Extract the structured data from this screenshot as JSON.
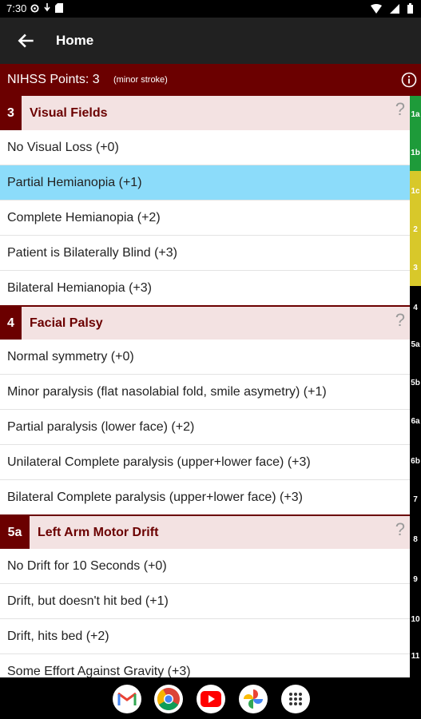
{
  "status_bar": {
    "time": "7:30"
  },
  "app_bar": {
    "title": "Home"
  },
  "score": {
    "label": "NIHSS Points: 3",
    "severity": "(minor stroke)"
  },
  "sections": [
    {
      "number": "3",
      "title": "Visual Fields",
      "help": "?",
      "options": [
        "No Visual Loss (+0)",
        "Partial Hemianopia (+1)",
        "Complete Hemianopia (+2)",
        "Patient is Bilaterally Blind (+3)",
        "Bilateral Hemianopia (+3)"
      ]
    },
    {
      "number": "4",
      "title": "Facial Palsy",
      "help": "?",
      "options": [
        "Normal symmetry (+0)",
        "Minor paralysis (flat nasolabial fold, smile asymetry) (+1)",
        "Partial paralysis (lower face) (+2)",
        "Unilateral Complete paralysis (upper+lower face) (+3)",
        "Bilateral Complete paralysis (upper+lower face) (+3)"
      ]
    },
    {
      "number": "5a",
      "title": "Left Arm Motor Drift",
      "help": "?",
      "options": [
        "No Drift for 10 Seconds (+0)",
        "Drift, but doesn't hit bed (+1)",
        "Drift, hits bed (+2)",
        "Some Effort Against Gravity (+3)"
      ]
    }
  ],
  "selected_option": "Partial Hemianopia (+1)",
  "index_tabs": [
    {
      "label": "1a",
      "color": "#1e9b3a"
    },
    {
      "label": "1b",
      "color": "#1e9b3a"
    },
    {
      "label": "1c",
      "color": "#d8c82a"
    },
    {
      "label": "2",
      "color": "#d8c82a"
    },
    {
      "label": "3",
      "color": "#d8c82a"
    },
    {
      "label": "4",
      "color": "#000000"
    },
    {
      "label": "5a",
      "color": "#000000"
    },
    {
      "label": "5b",
      "color": "#000000"
    },
    {
      "label": "6a",
      "color": "#000000"
    },
    {
      "label": "6b",
      "color": "#000000"
    },
    {
      "label": "7",
      "color": "#000000"
    },
    {
      "label": "8",
      "color": "#000000"
    },
    {
      "label": "9",
      "color": "#000000"
    },
    {
      "label": "10",
      "color": "#000000"
    },
    {
      "label": "11",
      "color": "#000000"
    }
  ],
  "dock_apps": [
    {
      "name": "gmail-icon"
    },
    {
      "name": "chrome-icon"
    },
    {
      "name": "youtube-icon"
    },
    {
      "name": "photos-icon"
    },
    {
      "name": "app-drawer-icon"
    }
  ],
  "colors": {
    "brand": "#6b0000",
    "header_bg": "#212121",
    "section_bg": "#f3e2e2",
    "selected": "#8cdcfa"
  }
}
